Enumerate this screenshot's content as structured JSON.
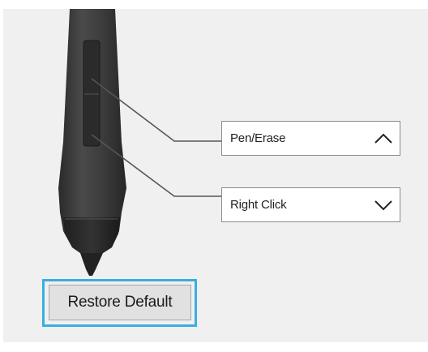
{
  "pen_buttons": {
    "upper": {
      "selected": "Pen/Erase",
      "chevron_icon": "chevron-up-icon"
    },
    "lower": {
      "selected": "Right Click",
      "chevron_icon": "chevron-down-icon"
    }
  },
  "actions": {
    "restore_label": "Restore Default"
  },
  "colors": {
    "highlight": "#3aaee0",
    "panel_background": "#f0f0f0",
    "pen_body": "#3b3b3b"
  }
}
